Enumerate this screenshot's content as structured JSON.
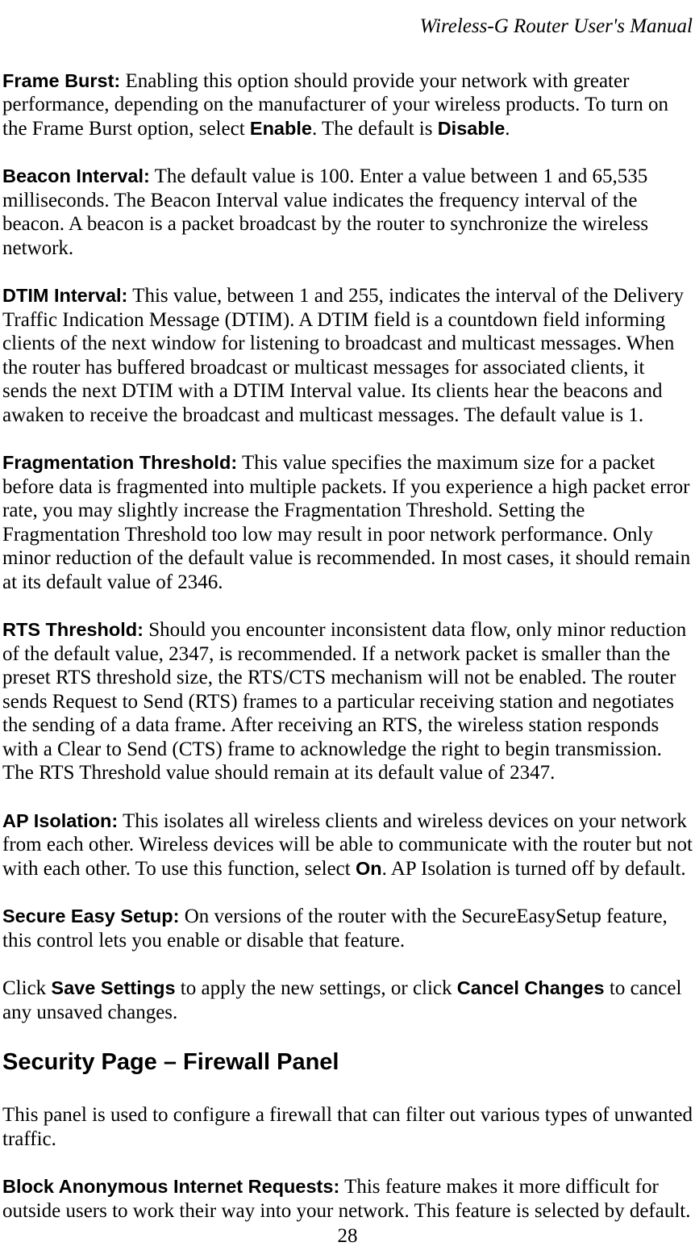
{
  "header": {
    "title": "Wireless-G Router User's Manual"
  },
  "sections": {
    "frameBurst": {
      "label": "Frame Burst:",
      "text1": " Enabling this option should provide your network with greater performance, depending on the manufacturer of your wireless products. To turn on the Frame Burst option, select ",
      "boldEnable": "Enable",
      "text2": ". The default is ",
      "boldDisable": "Disable",
      "text3": "."
    },
    "beaconInterval": {
      "label": "Beacon Interval:",
      "text": " The default value is 100. Enter a value between 1 and 65,535 milliseconds. The Beacon Interval value indicates the frequency interval of the beacon. A beacon is a packet broadcast by the router to synchronize the wireless network."
    },
    "dtimInterval": {
      "label": "DTIM Interval:",
      "text": " This value, between 1 and 255, indicates the interval of the Delivery Traffic Indication Message (DTIM). A DTIM field is a countdown field informing clients of the next window for listening to broadcast and multicast messages. When the router has buffered broadcast or multicast messages for associated clients, it sends the next DTIM with a DTIM Interval value. Its clients hear the beacons and awaken to receive the broadcast and multicast messages. The default value is 1."
    },
    "fragThreshold": {
      "label": "Fragmentation Threshold:",
      "text": " This value specifies the maximum size for a packet before data is fragmented into multiple packets. If you experience a high packet error rate, you may slightly increase the Fragmentation Threshold. Setting the Fragmentation Threshold too low may result in poor network performance. Only minor reduction of the default value is recommended. In most cases, it should remain at its default value of 2346."
    },
    "rtsThreshold": {
      "label": "RTS Threshold:",
      "text": " Should you encounter inconsistent data flow, only minor reduction of the default value, 2347, is recommended. If a network packet is smaller than the preset RTS threshold size, the RTS/CTS mechanism will not be enabled. The router sends Request to Send (RTS) frames to a particular receiving station and negotiates the sending of a data frame. After receiving an RTS, the wireless station responds with a Clear to Send (CTS) frame to acknowledge the right to begin transmission. The RTS Threshold value should remain at its default value of 2347."
    },
    "apIsolation": {
      "label": "AP Isolation:",
      "text1": " This isolates all wireless clients and wireless devices on your network from each other. Wireless devices will be able to communicate with the router but not with each other. To use this function, select ",
      "boldOn": "On",
      "text2": ". AP Isolation is turned off by default."
    },
    "secureEasySetup": {
      "label": "Secure Easy Setup:",
      "text": " On versions of the router with the SecureEasySetup feature, this control lets you enable or disable that feature."
    },
    "saveSettings": {
      "text1": "Click ",
      "boldSave": "Save Settings",
      "text2": " to apply the new settings, or click ",
      "boldCancel": "Cancel Changes",
      "text3": " to cancel any unsaved changes."
    },
    "securityHeading": "Security Page – Firewall Panel",
    "securityIntro": {
      "text": "This panel is used to configure a firewall that can filter out various types of unwanted traffic."
    },
    "blockAnonymous": {
      "label": "Block Anonymous Internet Requests:",
      "text": " This feature makes it more difficult for outside users to work their way into your network. This feature is selected by default."
    }
  },
  "pageNumber": "28"
}
